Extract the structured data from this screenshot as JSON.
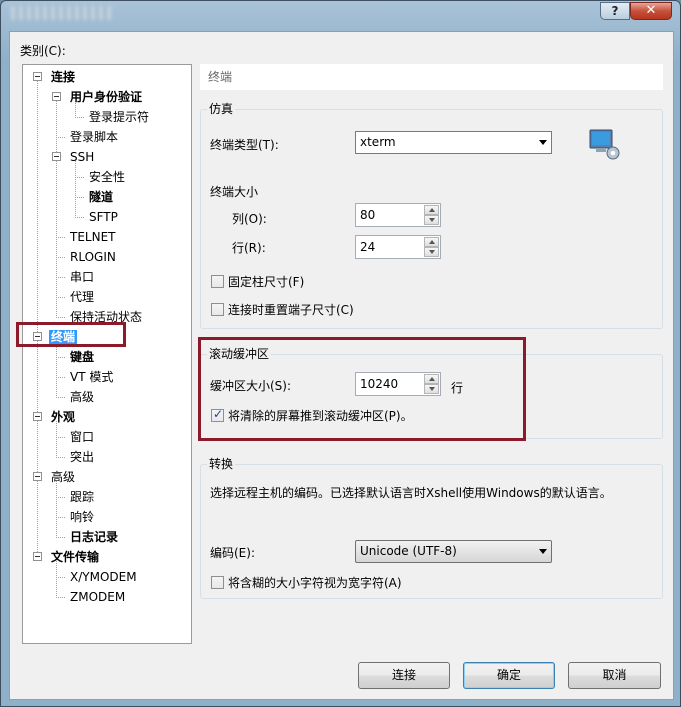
{
  "window": {
    "close_label": "✕",
    "help_label": "?"
  },
  "category_label": "类别(C):",
  "tree": [
    {
      "label": "连接",
      "bold": true
    },
    {
      "label": "用户身份验证",
      "bold": true
    },
    {
      "label": "登录提示符",
      "bold": false
    },
    {
      "label": "登录脚本",
      "bold": false
    },
    {
      "label": "SSH",
      "bold": false
    },
    {
      "label": "安全性",
      "bold": false
    },
    {
      "label": "隧道",
      "bold": true
    },
    {
      "label": "SFTP",
      "bold": false
    },
    {
      "label": "TELNET",
      "bold": false
    },
    {
      "label": "RLOGIN",
      "bold": false
    },
    {
      "label": "串口",
      "bold": false
    },
    {
      "label": "代理",
      "bold": false
    },
    {
      "label": "保持活动状态",
      "bold": false
    },
    {
      "label": "终端",
      "bold": true,
      "selected": true
    },
    {
      "label": "键盘",
      "bold": true
    },
    {
      "label": "VT 模式",
      "bold": false
    },
    {
      "label": "高级",
      "bold": false
    },
    {
      "label": "外观",
      "bold": true
    },
    {
      "label": "窗口",
      "bold": false
    },
    {
      "label": "突出",
      "bold": false
    },
    {
      "label": "高级",
      "bold": false
    },
    {
      "label": "跟踪",
      "bold": false
    },
    {
      "label": "响铃",
      "bold": false
    },
    {
      "label": "日志记录",
      "bold": true
    },
    {
      "label": "文件传输",
      "bold": true
    },
    {
      "label": "X/YMODEM",
      "bold": false
    },
    {
      "label": "ZMODEM",
      "bold": false
    }
  ],
  "header": "终端",
  "emulation": {
    "title": "仿真",
    "terminal_type_label": "终端类型(T):",
    "terminal_type_value": "xterm",
    "terminal_size_label": "终端大小",
    "cols_label": "列(O):",
    "cols_value": "80",
    "rows_label": "行(R):",
    "rows_value": "24",
    "fixed_size_label": "固定柱尺寸(F)",
    "fixed_size_checked": false,
    "reset_size_label": "连接时重置端子尺寸(C)",
    "reset_size_checked": false
  },
  "scroll": {
    "title": "滚动缓冲区",
    "buffer_size_label": "缓冲区大小(S):",
    "buffer_size_value": "10240",
    "buffer_unit": "行",
    "push_label": "将清除的屏幕推到滚动缓冲区(P)。",
    "push_checked": true
  },
  "conversion": {
    "title": "转换",
    "description": "选择远程主机的编码。已选择默认语言时Xshell使用Windows的默认语言。",
    "encoding_label": "编码(E):",
    "encoding_value": "Unicode (UTF-8)",
    "wide_char_label": "将含糊的大小字符视为宽字符(A)",
    "wide_char_checked": false
  },
  "buttons": {
    "connect": "连接",
    "ok": "确定",
    "cancel": "取消"
  },
  "colors": {
    "highlight": "#8b1a2a",
    "selection": "#3399ff"
  }
}
